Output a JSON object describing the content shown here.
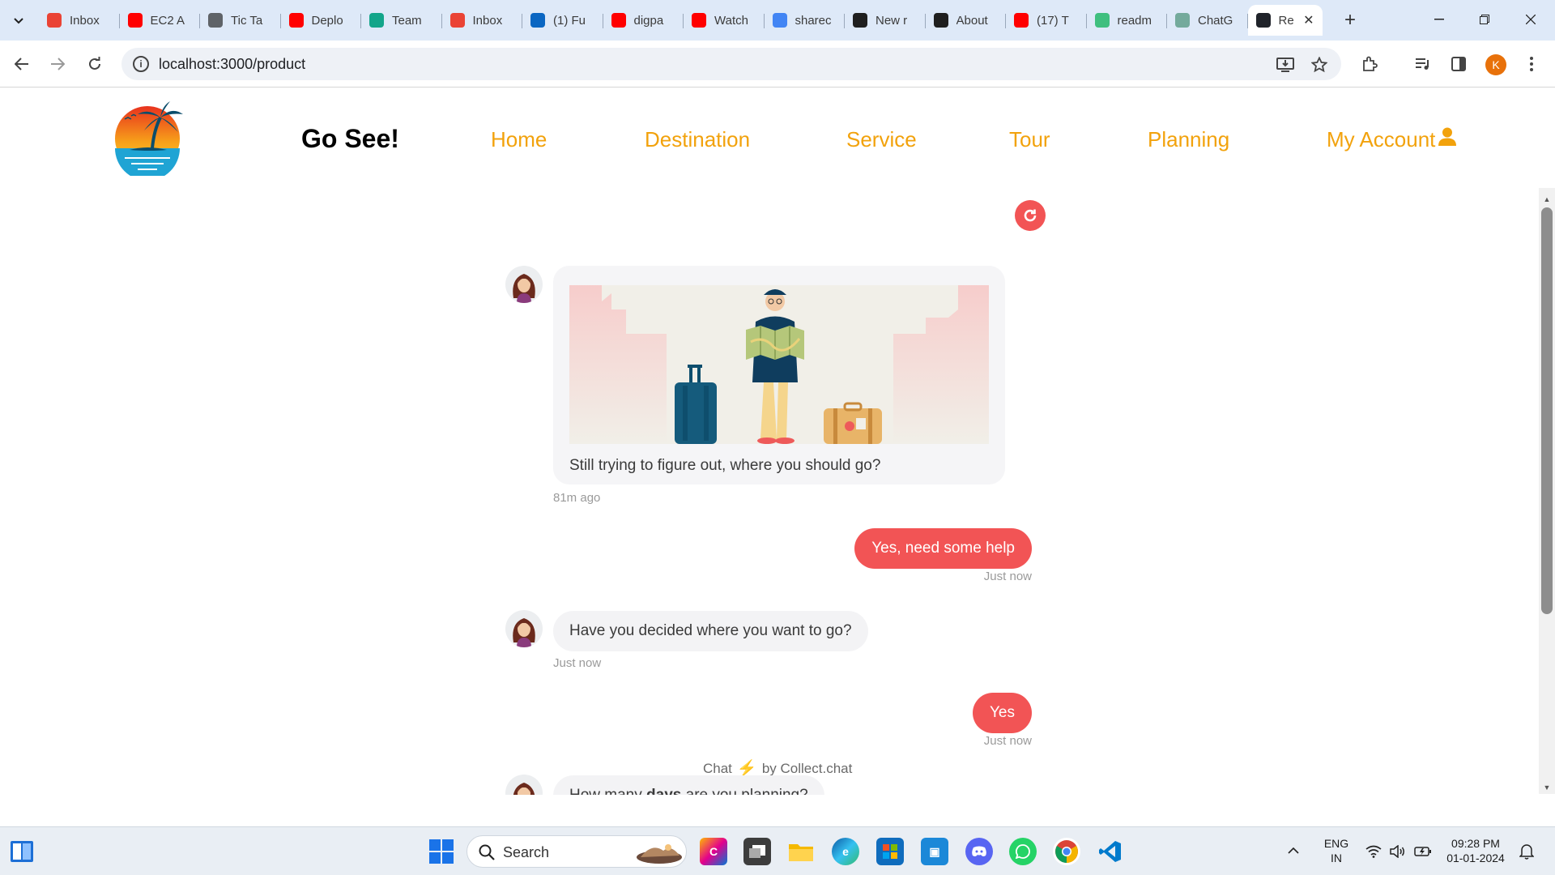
{
  "browser": {
    "tabs": [
      {
        "title": "Inbox",
        "icon": "gmail-icon",
        "color": "#ea4335"
      },
      {
        "title": "EC2 A",
        "icon": "youtube-icon",
        "color": "#ff0000"
      },
      {
        "title": "Tic Ta",
        "icon": "globe-icon",
        "color": "#5f6368"
      },
      {
        "title": "Deplo",
        "icon": "youtube-icon",
        "color": "#ff0000"
      },
      {
        "title": "Team",
        "icon": "diamond-icon",
        "color": "#13a58a"
      },
      {
        "title": "Inbox",
        "icon": "gmail-icon",
        "color": "#ea4335"
      },
      {
        "title": "(1) Fu",
        "icon": "linkedin-icon",
        "color": "#0a66c2"
      },
      {
        "title": "digpa",
        "icon": "youtube-icon",
        "color": "#ff0000"
      },
      {
        "title": "Watch",
        "icon": "youtube-icon",
        "color": "#ff0000"
      },
      {
        "title": "sharec",
        "icon": "google-icon",
        "color": "#4285f4"
      },
      {
        "title": "New r",
        "icon": "github-icon",
        "color": "#1f1f1f"
      },
      {
        "title": "About",
        "icon": "github-icon",
        "color": "#1f1f1f"
      },
      {
        "title": "(17) T",
        "icon": "youtube-icon",
        "color": "#ff0000"
      },
      {
        "title": "readm",
        "icon": "app-icon",
        "color": "#3fbf7f"
      },
      {
        "title": "ChatG",
        "icon": "chatgpt-icon",
        "color": "#74aa9c"
      },
      {
        "title": "Re",
        "icon": "react-icon",
        "color": "#20232a",
        "active": true
      }
    ],
    "url": "localhost:3000/product",
    "profile_initial": "K"
  },
  "header": {
    "brand": "Go See!",
    "nav": [
      "Home",
      "Destination",
      "Service",
      "Tour",
      "Planning",
      "My Account"
    ]
  },
  "chat": {
    "intro_text": "Still trying to figure out, where you should go?",
    "intro_time": "81m ago",
    "reply1": "Yes, need some help",
    "reply1_time": "Just now",
    "question2": "Have you decided where you want to go?",
    "question2_time": "Just now",
    "reply2": "Yes",
    "reply2_time": "Just now",
    "question3_prefix": "How many ",
    "question3_bold": "days",
    "question3_suffix": " are you planning?",
    "powered_chat": "Chat",
    "powered_by": "by Collect.chat",
    "accent_color": "#f25455"
  },
  "taskbar": {
    "search_placeholder": "Search",
    "language": "ENG",
    "region": "IN",
    "time": "09:28 PM",
    "date": "01-01-2024"
  }
}
